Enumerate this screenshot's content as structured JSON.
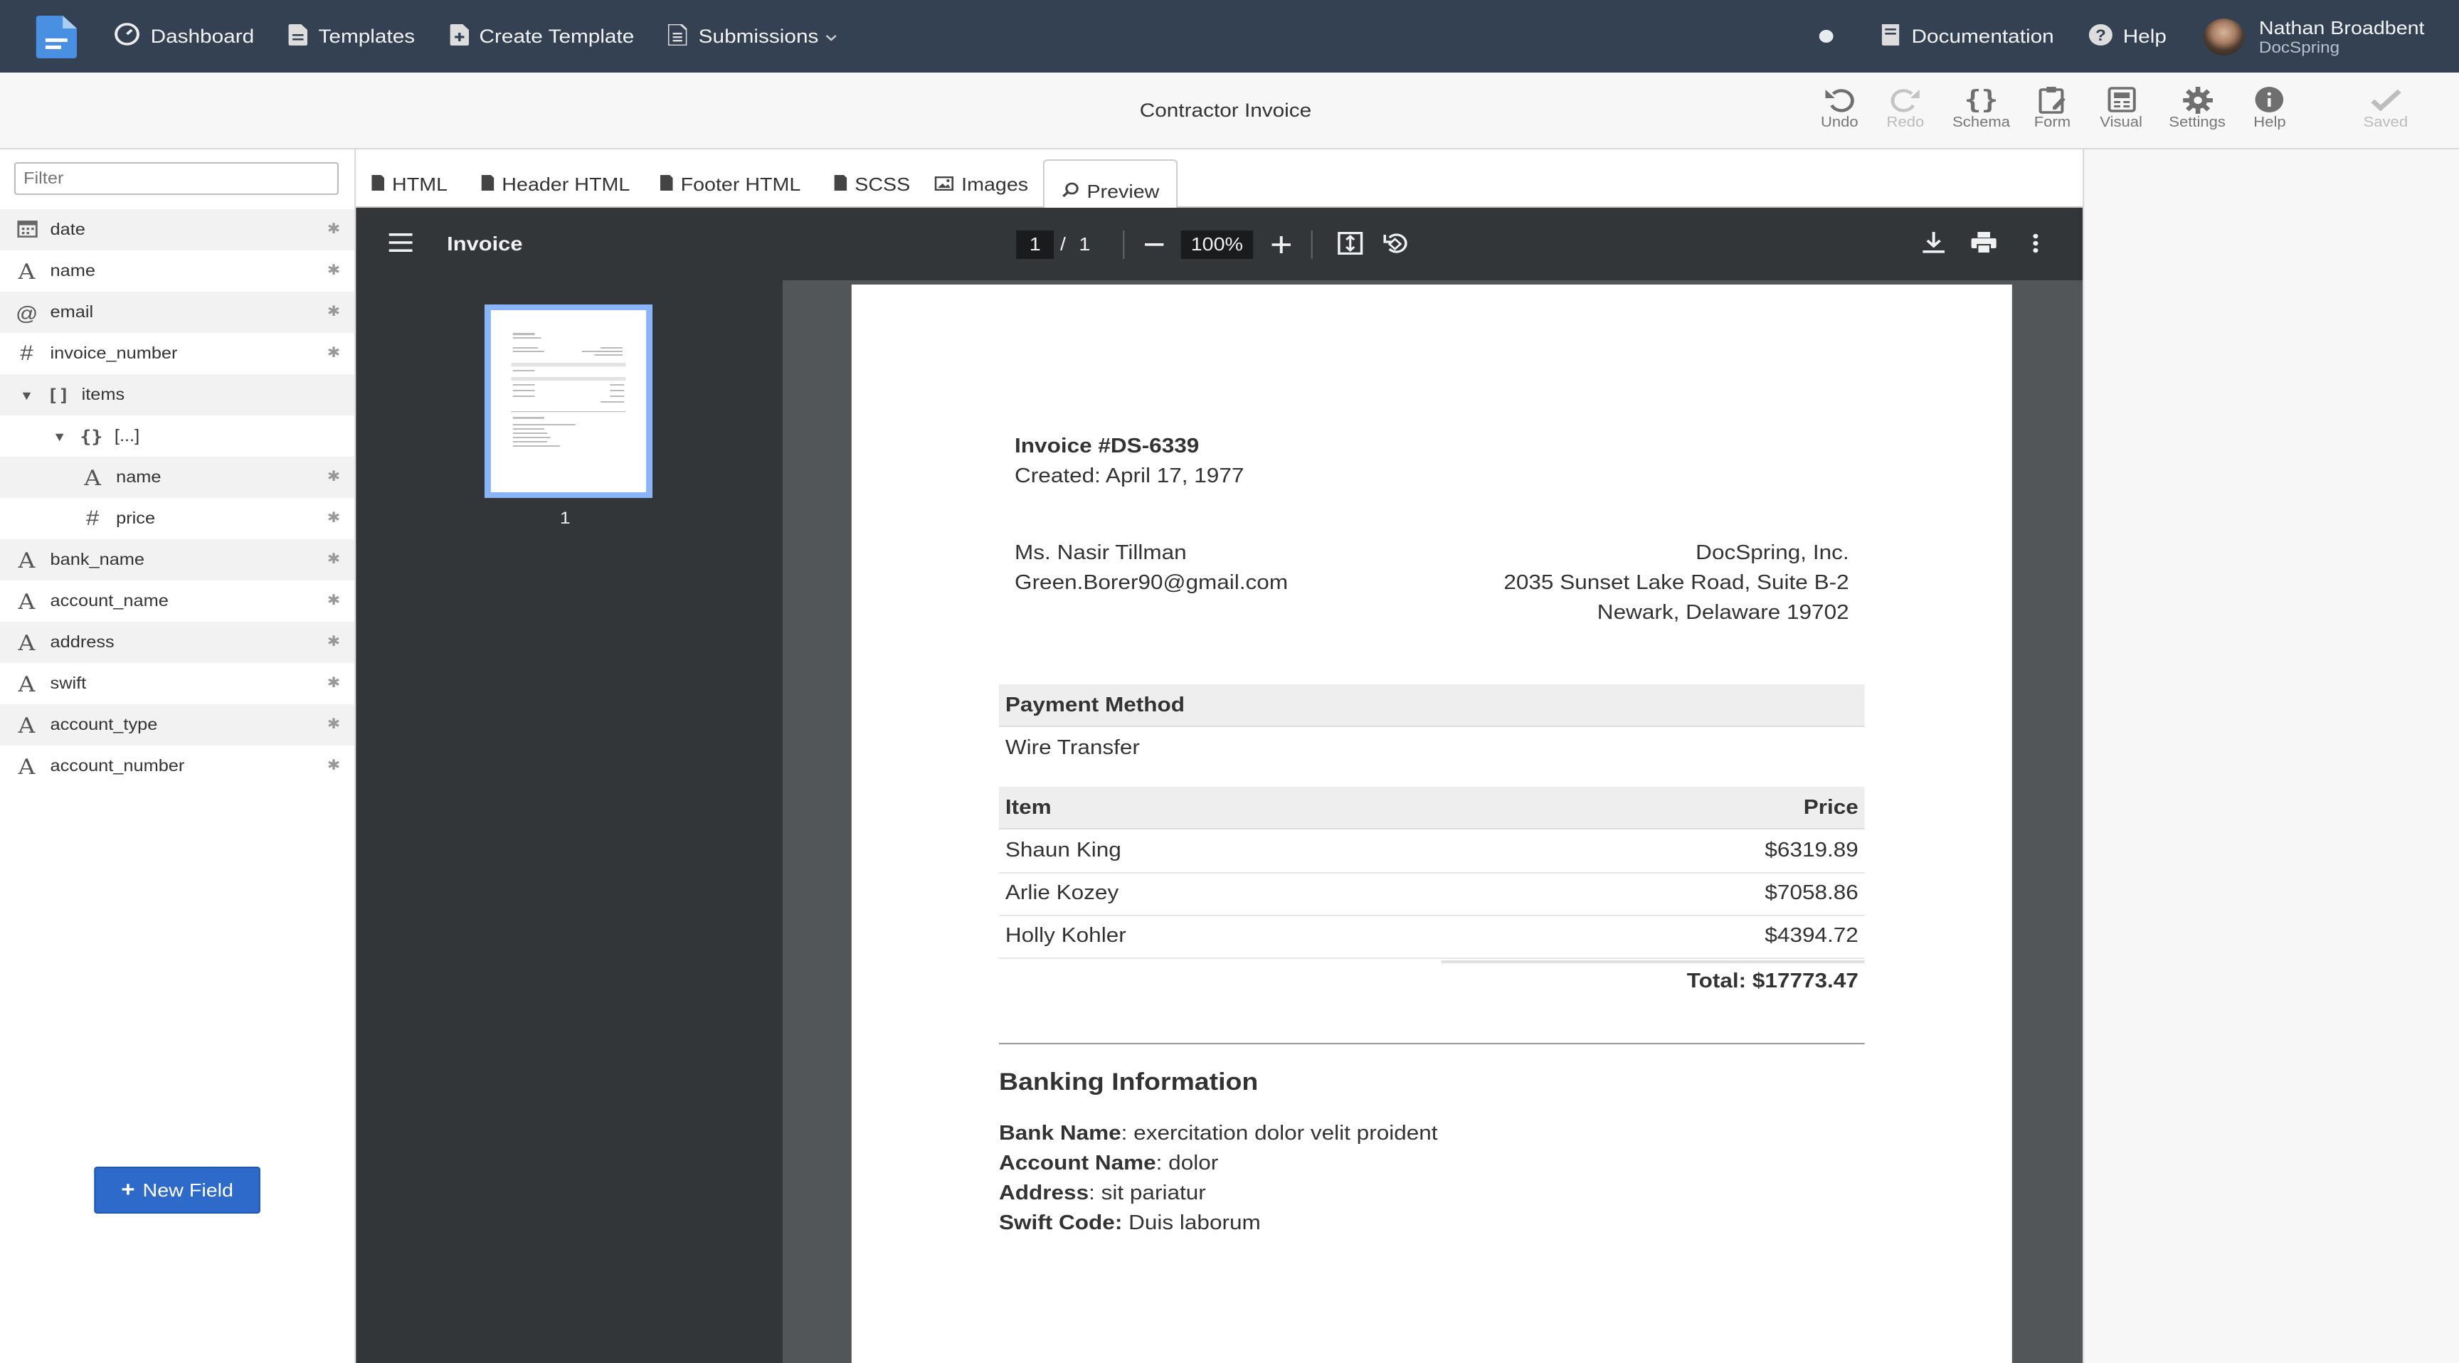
{
  "nav": {
    "items": [
      {
        "label": "Dashboard",
        "icon": "dashboard-icon"
      },
      {
        "label": "Templates",
        "icon": "file-icon"
      },
      {
        "label": "Create Template",
        "icon": "file-plus-icon"
      },
      {
        "label": "Submissions",
        "icon": "file-text-icon"
      }
    ],
    "documentation": "Documentation",
    "help": "Help",
    "user_name": "Nathan Broadbent",
    "user_org": "DocSpring"
  },
  "toolbar": {
    "title": "Contractor Invoice",
    "buttons": [
      {
        "label": "Undo",
        "icon": "undo-icon",
        "enabled": true
      },
      {
        "label": "Redo",
        "icon": "redo-icon",
        "enabled": false
      },
      {
        "label": "Schema",
        "icon": "braces-icon",
        "enabled": true
      },
      {
        "label": "Form",
        "icon": "form-icon",
        "enabled": true
      },
      {
        "label": "Visual",
        "icon": "visual-icon",
        "enabled": true
      },
      {
        "label": "Settings",
        "icon": "gear-icon",
        "enabled": true
      },
      {
        "label": "Help",
        "icon": "info-icon",
        "enabled": true
      },
      {
        "label": "Saved",
        "icon": "check-icon",
        "enabled": false
      }
    ]
  },
  "sidebar": {
    "filter_placeholder": "Filter",
    "fields": [
      {
        "name": "date",
        "type": "date",
        "required": true
      },
      {
        "name": "name",
        "type": "string",
        "required": true
      },
      {
        "name": "email",
        "type": "email",
        "required": true
      },
      {
        "name": "invoice_number",
        "type": "number",
        "required": true
      },
      {
        "name": "items",
        "type": "array",
        "required": false
      },
      {
        "name": "[...]",
        "type": "object",
        "required": false
      },
      {
        "name": "name",
        "type": "string",
        "required": true
      },
      {
        "name": "price",
        "type": "number",
        "required": true
      },
      {
        "name": "bank_name",
        "type": "string",
        "required": true
      },
      {
        "name": "account_name",
        "type": "string",
        "required": true
      },
      {
        "name": "address",
        "type": "string",
        "required": true
      },
      {
        "name": "swift",
        "type": "string",
        "required": true
      },
      {
        "name": "account_type",
        "type": "string",
        "required": true
      },
      {
        "name": "account_number",
        "type": "string",
        "required": true
      }
    ],
    "new_field": "New Field"
  },
  "tabs": [
    {
      "label": "HTML",
      "icon": "file-icon",
      "active": false
    },
    {
      "label": "Header HTML",
      "icon": "file-icon",
      "active": false
    },
    {
      "label": "Footer HTML",
      "icon": "file-icon",
      "active": false
    },
    {
      "label": "SCSS",
      "icon": "file-icon",
      "active": false
    },
    {
      "label": "Images",
      "icon": "image-icon",
      "active": false
    },
    {
      "label": "Preview",
      "icon": "search-icon",
      "active": true
    }
  ],
  "pdf": {
    "title": "Invoice",
    "page_current": "1",
    "page_separator": "/",
    "page_total": "1",
    "zoom": "100%",
    "thumb_label": "1"
  },
  "invoice": {
    "heading": "Invoice #DS-6339",
    "created": "Created: April 17, 1977",
    "client_name": "Ms. Nasir Tillman",
    "client_email": "Green.Borer90@gmail.com",
    "company": "DocSpring, Inc.",
    "company_address1": "2035 Sunset Lake Road, Suite B-2",
    "company_address2": "Newark, Delaware 19702",
    "payment_method_label": "Payment Method",
    "payment_method": "Wire Transfer",
    "item_header": "Item",
    "price_header": "Price",
    "items": [
      {
        "name": "Shaun King",
        "price": "$6319.89"
      },
      {
        "name": "Arlie Kozey",
        "price": "$7058.86"
      },
      {
        "name": "Holly Kohler",
        "price": "$4394.72"
      }
    ],
    "total": "Total: $17773.47",
    "banking_title": "Banking Information",
    "bank_name_label": "Bank Name",
    "bank_name": ": exercitation dolor velit proident",
    "account_name_label": "Account Name",
    "account_name": ": dolor",
    "address_label": "Address",
    "address": ": sit pariatur",
    "swift_label": "Swift Code:",
    "swift": " Duis laborum"
  }
}
